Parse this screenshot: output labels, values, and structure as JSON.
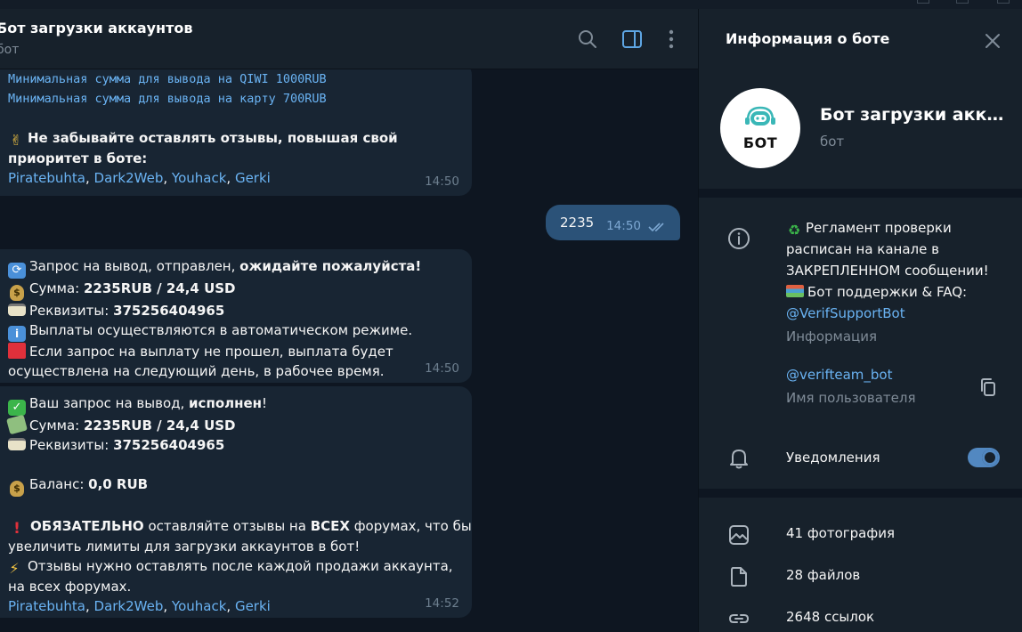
{
  "chat": {
    "title": "Бот загрузки аккаунтов",
    "subtitle": "бот",
    "messages": {
      "m1": {
        "mono_lines": [
          "Минимальная сумма для вывода на QIWI 1000RUB",
          "Минимальная сумма для вывода на карту 700RUB"
        ],
        "line1_emoji": "✌",
        "line1_text": "Не забывайте оставлять отзывы, повышая свой",
        "line2_text": "приоритет в боте:",
        "links": [
          "Piratebuhta",
          "Dark2Web",
          "Youhack",
          "Gerki"
        ],
        "sep": ", ",
        "time": "14:50"
      },
      "m2": {
        "text": "2235",
        "time": "14:50"
      },
      "m3": {
        "l1a": "Запрос на вывод,  отправлен, ",
        "l1b": "ожидайте пожалуйста!",
        "l2a": "Сумма: ",
        "l2b": "2235RUB  / 24,4 USD",
        "l3a": "Реквизиты: ",
        "l3b": "375256404965",
        "l4": "Выплаты осуществляются в автоматическом режиме.",
        "l5": "Если запрос на выплату не прошел, выплата будет",
        "l6": "осуществлена на следующий день, в рабочее время.",
        "time": "14:50"
      },
      "m4": {
        "l1a": "Ваш запрос на вывод, ",
        "l1b": "исполнен",
        "l1c": "!",
        "l2a": "Сумма: ",
        "l2b": "2235RUB  / 24,4 USD",
        "l3a": "Реквизиты: ",
        "l3b": "375256404965",
        "l4a": "Баланс: ",
        "l4b": "0,0 RUB",
        "l5a": "ОБЯЗАТЕЛЬНО",
        "l5b": " оставляйте отзывы на ",
        "l5c": "ВСЕХ",
        "l5d": " форумах, что бы",
        "l6": "увеличить лимиты для загрузки аккаунтов в бот!",
        "l7": "Отзывы нужно оставлять после каждой продажи аккаунта,",
        "l8": "на всех форумах.",
        "links": [
          "Piratebuhta",
          "Dark2Web",
          "Youhack",
          "Gerki"
        ],
        "sep": ", ",
        "time": "14:52"
      }
    }
  },
  "panel": {
    "title": "Информация о боте",
    "avatar_text": "БОТ",
    "bot_name": "Бот загрузки аккаунтов",
    "bot_sub": "бот",
    "about_lines": [
      "Регламент проверки",
      "расписан на канале в",
      "ЗАКРЕПЛЕННОМ сообщении!",
      "Бот поддержки & FAQ:"
    ],
    "about_link": "@VerifSupportBot",
    "about_caption": "Информация",
    "username": "@verifteam_bot",
    "username_caption": "Имя пользователя",
    "notifications": "Уведомления",
    "notifications_on": true,
    "media": {
      "photos": "41 фотография",
      "files": "28 файлов",
      "links": "2648 ссылок"
    }
  },
  "colors": {
    "accent": "#5288c1",
    "link": "#6ab3f3",
    "bg": "#0e1621",
    "panel_bg": "#17212b",
    "bubble_in": "#182533",
    "bubble_out": "#2b5278"
  },
  "icons": [
    "search-icon",
    "sidebar-toggle-icon",
    "more-vertical-icon",
    "close-icon",
    "info-icon",
    "copy-icon",
    "bell-icon",
    "photo-icon",
    "file-icon",
    "link-icon",
    "double-check-icon"
  ]
}
